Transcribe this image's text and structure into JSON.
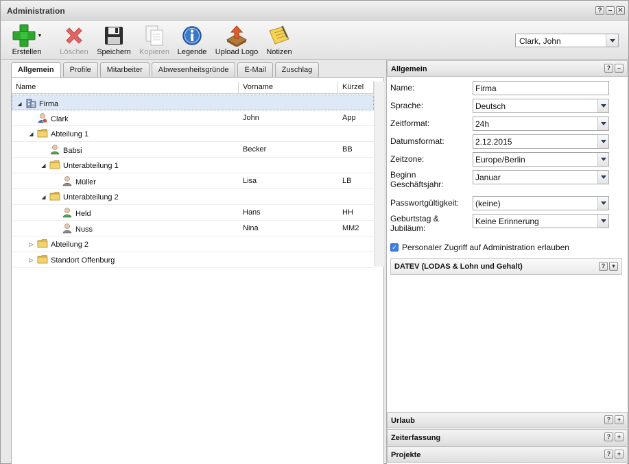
{
  "window": {
    "title": "Administration"
  },
  "toolbar": {
    "items": [
      {
        "label": "Erstellen",
        "icon": "plus-icon"
      },
      {
        "label": "Löschen",
        "icon": "delete-x-icon"
      },
      {
        "label": "Speichern",
        "icon": "floppy-disk-icon"
      },
      {
        "label": "Kopieren",
        "icon": "copy-icon"
      },
      {
        "label": "Legende",
        "icon": "info-icon"
      },
      {
        "label": "Upload Logo",
        "icon": "upload-icon"
      },
      {
        "label": "Notizen",
        "icon": "notes-icon"
      }
    ],
    "user_select": "Clark, John"
  },
  "tabs": [
    "Allgemein",
    "Profile",
    "Mitarbeiter",
    "Abwesenheitsgründe",
    "E-Mail",
    "Zuschlag"
  ],
  "grid": {
    "columns": [
      "Name",
      "Vorname",
      "Kürzel"
    ],
    "rows": [
      {
        "name": "Firma",
        "vorname": "",
        "kuerzel": "",
        "icon": "building-icon",
        "expand": "expanded",
        "level": 0
      },
      {
        "name": "Clark",
        "vorname": "John",
        "kuerzel": "App",
        "icon": "admin-user-icon",
        "expand": "",
        "level": 1
      },
      {
        "name": "Abteilung 1",
        "vorname": "",
        "kuerzel": "",
        "icon": "folder-icon",
        "expand": "expanded",
        "level": 1
      },
      {
        "name": "Babsi",
        "vorname": "Becker",
        "kuerzel": "BB",
        "icon": "user-green-icon",
        "expand": "",
        "level": 2
      },
      {
        "name": "Unterabteilung 1",
        "vorname": "",
        "kuerzel": "",
        "icon": "folder-icon",
        "expand": "expanded",
        "level": 2
      },
      {
        "name": "Müller",
        "vorname": "Lisa",
        "kuerzel": "LB",
        "icon": "user-grey-icon",
        "expand": "",
        "level": 3
      },
      {
        "name": "Unterabteilung 2",
        "vorname": "",
        "kuerzel": "",
        "icon": "folder-icon",
        "expand": "expanded",
        "level": 2
      },
      {
        "name": "Held",
        "vorname": "Hans",
        "kuerzel": "HH",
        "icon": "user-green-icon",
        "expand": "",
        "level": 3
      },
      {
        "name": "Nuss",
        "vorname": "Nina",
        "kuerzel": "MM2",
        "icon": "user-grey-icon",
        "expand": "",
        "level": 3
      },
      {
        "name": "Abteilung 2",
        "vorname": "",
        "kuerzel": "",
        "icon": "folder-icon",
        "expand": "collapsed",
        "level": 1
      },
      {
        "name": "Standort Offenburg",
        "vorname": "",
        "kuerzel": "",
        "icon": "folder-icon",
        "expand": "collapsed",
        "level": 1
      }
    ]
  },
  "panel": {
    "title": "Allgemein",
    "fields": [
      {
        "label": "Name:",
        "value": "Firma",
        "type": "text"
      },
      {
        "label": "Sprache:",
        "value": "Deutsch",
        "type": "select"
      },
      {
        "label": "Zeitformat:",
        "value": "24h",
        "type": "select"
      },
      {
        "label": "Datumsformat:",
        "value": "2.12.2015",
        "type": "select"
      },
      {
        "label": "Zeitzone:",
        "value": "Europe/Berlin",
        "type": "select"
      },
      {
        "label": "Beginn\nGeschäftsjahr:",
        "value": "Januar",
        "type": "select"
      },
      {
        "label": "Passwortgültigkeit:",
        "value": "(keine)",
        "type": "select"
      },
      {
        "label": "Geburtstag &\nJubiläum:",
        "value": "Keine Erinnerung",
        "type": "select"
      }
    ],
    "checkbox_label": "Personaler Zugriff auf Administration erlauben",
    "checkbox_checked": true,
    "datev_title": "DATEV (LODAS & Lohn und Gehalt)"
  },
  "collapsed_panels": [
    "Urlaub",
    "Zeiterfassung",
    "Projekte"
  ]
}
